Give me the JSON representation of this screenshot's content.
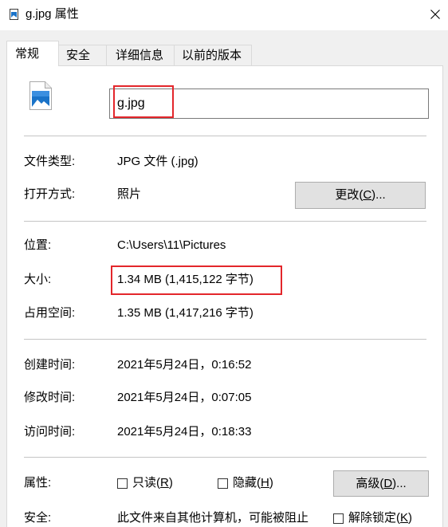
{
  "window": {
    "title": "g.jpg 属性",
    "title_icon": "image-file-icon",
    "close_icon": "close-icon"
  },
  "tabs": [
    {
      "label": "常规",
      "selected": true
    },
    {
      "label": "安全",
      "selected": false
    },
    {
      "label": "详细信息",
      "selected": false
    },
    {
      "label": "以前的版本",
      "selected": false
    }
  ],
  "general": {
    "file_icon": "image-file-icon",
    "filename": "g.jpg",
    "file_type": {
      "label": "文件类型:",
      "value": "JPG 文件 (.jpg)"
    },
    "opens_with": {
      "label": "打开方式:",
      "value": "照片",
      "change_button": "更改(C)..."
    },
    "location": {
      "label": "位置:",
      "value": "C:\\Users\\11\\Pictures"
    },
    "size": {
      "label": "大小:",
      "value": "1.34 MB (1,415,122 字节)"
    },
    "size_on_disk": {
      "label": "占用空间:",
      "value": "1.35 MB (1,417,216 字节)"
    },
    "created": {
      "label": "创建时间:",
      "value": "2021年5月24日，0:16:52"
    },
    "modified": {
      "label": "修改时间:",
      "value": "2021年5月24日，0:07:05"
    },
    "accessed": {
      "label": "访问时间:",
      "value": "2021年5月24日，0:18:33"
    },
    "attributes": {
      "label": "属性:",
      "read_only": {
        "label": "只读(R)",
        "checked": false
      },
      "hidden": {
        "label": "隐藏(H)",
        "checked": false
      },
      "advanced_button": "高级(D)..."
    },
    "security": {
      "label": "安全:",
      "message": "此文件来自其他计算机，可能被阻止",
      "unblock": {
        "label": "解除锁定(K)",
        "checked": false
      }
    }
  },
  "colors": {
    "highlight": "#e3262b"
  }
}
